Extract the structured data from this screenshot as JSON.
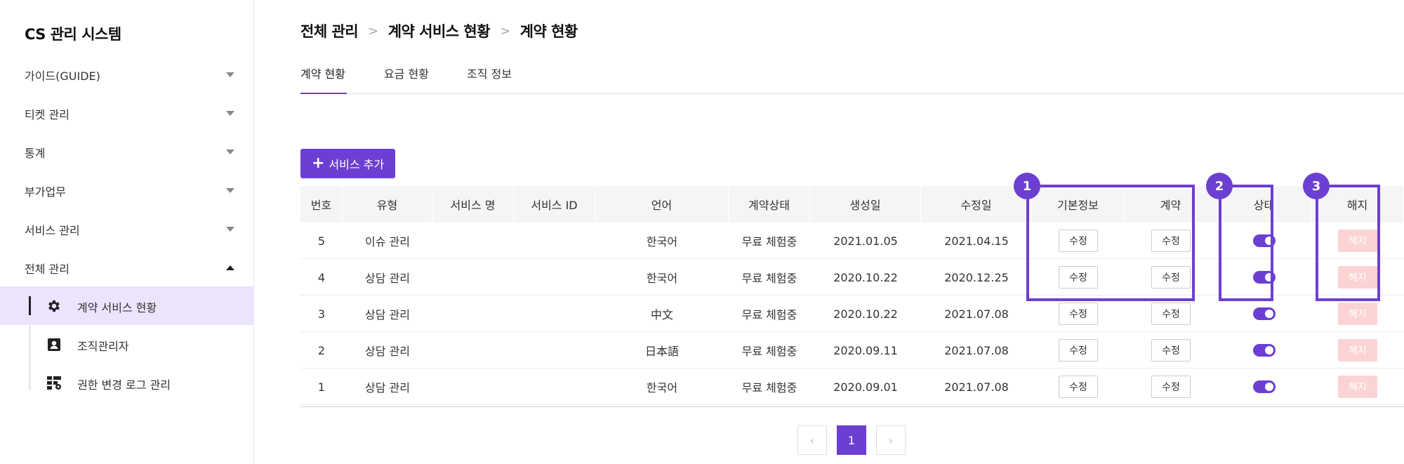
{
  "sidebar": {
    "title": "CS 관리 시스템",
    "menu": [
      {
        "label": "가이드(GUIDE)",
        "expanded": false
      },
      {
        "label": "티켓 관리",
        "expanded": false
      },
      {
        "label": "통계",
        "expanded": false
      },
      {
        "label": "부가업무",
        "expanded": false
      },
      {
        "label": "서비스 관리",
        "expanded": false
      },
      {
        "label": "전체 관리",
        "expanded": true
      }
    ],
    "submenu": [
      {
        "label": "계약 서비스 현황",
        "icon": "gear-icon",
        "active": true
      },
      {
        "label": "조직관리자",
        "icon": "id-badge-icon",
        "active": false
      },
      {
        "label": "권한 변경 로그 관리",
        "icon": "grid-settings-icon",
        "active": false
      }
    ]
  },
  "breadcrumb": [
    "전체 관리",
    "계약 서비스 현황",
    "계약 현황"
  ],
  "tabs": [
    {
      "label": "계약 현황",
      "active": true
    },
    {
      "label": "요금 현황",
      "active": false
    },
    {
      "label": "조직 정보",
      "active": false
    }
  ],
  "add_button": {
    "label": "서비스 추가"
  },
  "table": {
    "headers": [
      "번호",
      "유형",
      "서비스 명",
      "서비스 ID",
      "언어",
      "계약상태",
      "생성일",
      "수정일",
      "기본정보",
      "계약",
      "상태",
      "해지"
    ],
    "edit_label": "수정",
    "cancel_label": "해지",
    "rows": [
      {
        "no": "5",
        "type": "이슈 관리",
        "name": "",
        "id": "",
        "lang": "한국어",
        "status": "무료 체험중",
        "created": "2021.01.05",
        "updated": "2021.04.15",
        "enabled": true
      },
      {
        "no": "4",
        "type": "상담 관리",
        "name": "",
        "id": "",
        "lang": "한국어",
        "status": "무료 체험중",
        "created": "2020.10.22",
        "updated": "2020.12.25",
        "enabled": true
      },
      {
        "no": "3",
        "type": "상담 관리",
        "name": "",
        "id": "",
        "lang": "中文",
        "status": "무료 체험중",
        "created": "2020.10.22",
        "updated": "2021.07.08",
        "enabled": true
      },
      {
        "no": "2",
        "type": "상담 관리",
        "name": "",
        "id": "",
        "lang": "日本語",
        "status": "무료 체험중",
        "created": "2020.09.11",
        "updated": "2021.07.08",
        "enabled": true
      },
      {
        "no": "1",
        "type": "상담 관리",
        "name": "",
        "id": "",
        "lang": "한국어",
        "status": "무료 체험중",
        "created": "2020.09.01",
        "updated": "2021.07.08",
        "enabled": true
      }
    ]
  },
  "annotations": [
    "1",
    "2",
    "3"
  ],
  "pagination": {
    "current": "1"
  },
  "colors": {
    "accent": "#6c3fd3",
    "active_bg": "#ece4fd",
    "cancel_bg": "#fbd3d3"
  }
}
